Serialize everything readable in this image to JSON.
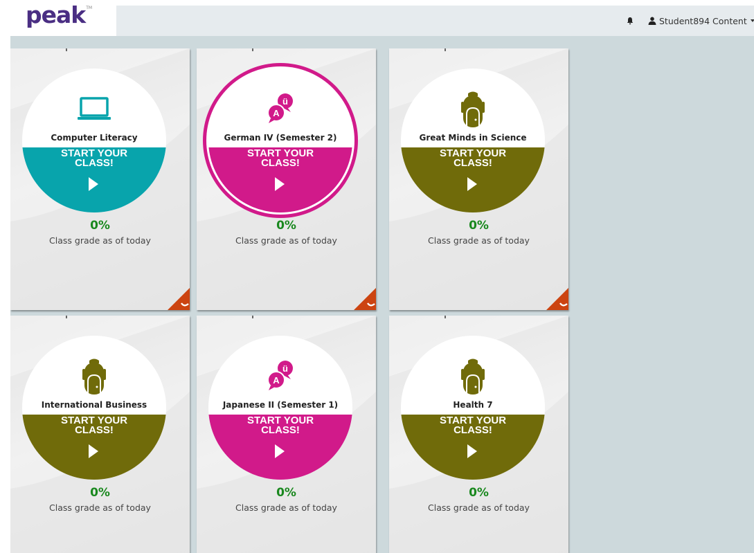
{
  "header": {
    "logo_text": "peak",
    "logo_tm": "TM",
    "user_label": "Student894 Content"
  },
  "colors": {
    "teal": "#08a4ac",
    "magenta": "#d11a8a",
    "olive": "#706b0a",
    "grade_green": "#19881e",
    "logo_purple": "#4a2e83",
    "corner_orange": "#cc4411"
  },
  "courses": [
    {
      "name": "Computer Literacy",
      "start_line1": "START YOUR",
      "start_line2": "CLASS!",
      "percent": "0%",
      "grade_label": "Class grade as of today",
      "icon": "laptop-icon"
    },
    {
      "name": "German IV (Semester 2)",
      "start_line1": "START YOUR",
      "start_line2": "CLASS!",
      "percent": "0%",
      "grade_label": "Class grade as of today",
      "icon": "language-bubbles-icon"
    },
    {
      "name": "Great Minds in Science",
      "start_line1": "START YOUR",
      "start_line2": "CLASS!",
      "percent": "0%",
      "grade_label": "Class grade as of today",
      "icon": "backpack-icon"
    },
    {
      "name": "International Business",
      "start_line1": "START YOUR",
      "start_line2": "CLASS!",
      "percent": "0%",
      "grade_label": "Class grade as of today",
      "icon": "backpack-icon"
    },
    {
      "name": "Japanese II (Semester 1)",
      "start_line1": "START YOUR",
      "start_line2": "CLASS!",
      "percent": "0%",
      "grade_label": "Class grade as of today",
      "icon": "language-bubbles-icon"
    },
    {
      "name": "Health 7",
      "start_line1": "START YOUR",
      "start_line2": "CLASS!",
      "percent": "0%",
      "grade_label": "Class grade as of today",
      "icon": "backpack-icon"
    }
  ]
}
